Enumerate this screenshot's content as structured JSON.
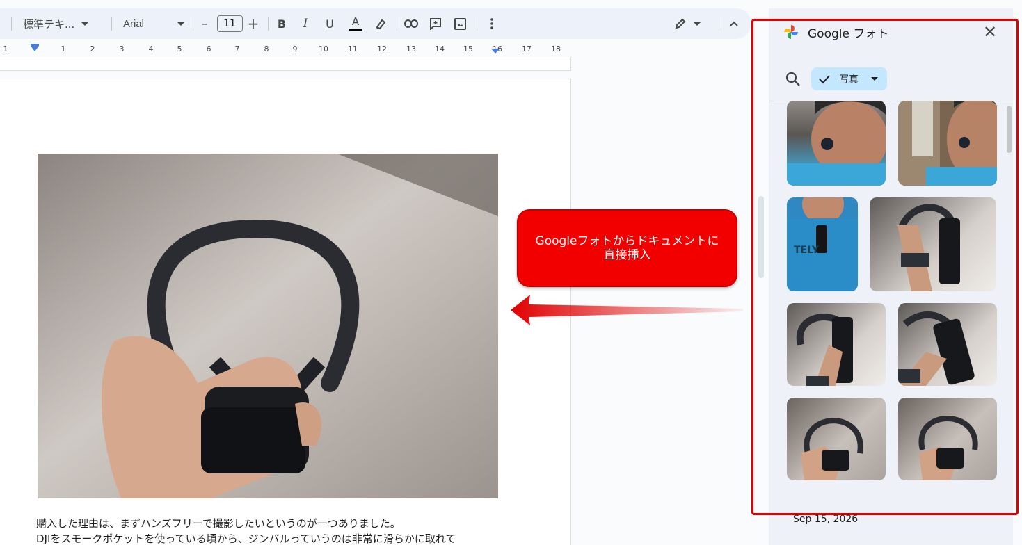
{
  "toolbar": {
    "style_label": "標準テキ...",
    "font_label": "Arial",
    "font_size": "11",
    "minus": "–",
    "plus": "+",
    "bold": "B",
    "italic": "I",
    "underline": "U",
    "text_color": "A"
  },
  "ruler": {
    "ticks": [
      "1",
      "1",
      "2",
      "3",
      "4",
      "5",
      "6",
      "7",
      "8",
      "9",
      "10",
      "11",
      "12",
      "13",
      "14",
      "15",
      "16",
      "17",
      "18"
    ]
  },
  "document": {
    "lines": [
      "購入した理由は、まずハンズフリーで撮影したいというのが一つありました。",
      "DJIをスモークポケットを使っている頃から、ジンバルっていうのは非常に滑らかに取れて"
    ]
  },
  "callout": {
    "line1": "Googleフォトからドキュメントに",
    "line2": "直接挿入"
  },
  "panel": {
    "title": "Google フォト",
    "close": "✕",
    "filter_label": "写真",
    "date": "Sep 15, 2026"
  },
  "colors": {
    "accent": "#e00000",
    "chip": "#c2e7ff",
    "toolbar_bg": "#edf2fa"
  }
}
